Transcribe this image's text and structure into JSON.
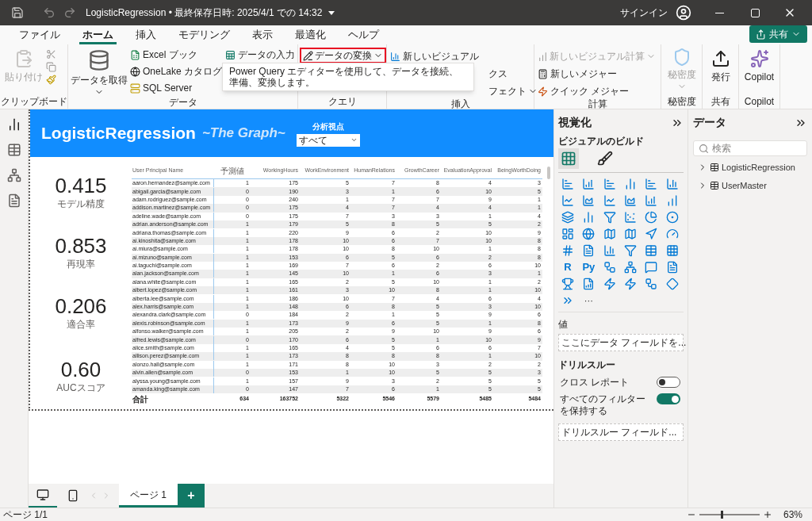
{
  "window": {
    "title": "LogisticRegression • 最終保存日時: 2025/4/1 での 14:32",
    "sign_in": "サインイン"
  },
  "menu_tabs": [
    {
      "label": "ファイル",
      "selected": false
    },
    {
      "label": "ホーム",
      "selected": true
    },
    {
      "label": "挿入",
      "selected": false
    },
    {
      "label": "モデリング",
      "selected": false
    },
    {
      "label": "表示",
      "selected": false
    },
    {
      "label": "最適化",
      "selected": false
    },
    {
      "label": "ヘルプ",
      "selected": false
    }
  ],
  "share_button": "共有",
  "ribbon": {
    "clipboard": {
      "paste": "貼り付け",
      "label": "クリップボード"
    },
    "data": {
      "get_data": "データを取得",
      "excel": "Excel ブック",
      "onelake": "OneLake カタログ",
      "sql": "SQL Server",
      "enter_data": "データの入力",
      "label": "データ"
    },
    "query": {
      "transform": "データの変換",
      "label": "クエリ"
    },
    "insert": {
      "new_visual": "新しいビジュアル",
      "item_2": "クス",
      "item_3": "フェクト",
      "label": "挿入"
    },
    "calc": {
      "visual_calc": "新しいビジュアル計算",
      "new_measure": "新しいメジャー",
      "quick_measure": "クイック メジャー",
      "label": "計算"
    },
    "sensitivity": {
      "button": "秘密度",
      "label": "秘密度"
    },
    "share": {
      "publish": "発行",
      "label": "共有"
    },
    "copilot": {
      "button": "Copilot",
      "label": "Copilot"
    }
  },
  "tooltip": "Power Query エディターを使用して、データを接続、準備、変換します。",
  "report": {
    "title": "LogisticRegression",
    "subtitle": "~The Graph~",
    "slicer": {
      "label": "分析視点",
      "value": "すべて"
    },
    "kpis": [
      {
        "value": "0.415",
        "label": "モデル精度"
      },
      {
        "value": "0.853",
        "label": "再現率"
      },
      {
        "value": "0.206",
        "label": "適合率"
      },
      {
        "value": "0.60",
        "label": "AUCスコア"
      }
    ],
    "table": {
      "columns": [
        "User Principal Name",
        "予測値",
        "WorkingHours",
        "WorkEnvironment",
        "HumanRelations",
        "GrowthCareer",
        "EvaluationApproval",
        "BeingWorthDoing"
      ],
      "rows": [
        [
          "aaron.hernandez@sample.com",
          "1",
          "175",
          "5",
          "7",
          "8",
          "4",
          "3"
        ],
        [
          "abigail.garcia@sample.com",
          "0",
          "190",
          "3",
          "1",
          "6",
          "10",
          "5"
        ],
        [
          "adam.rodriguez@sample.com",
          "0",
          "240",
          "1",
          "7",
          "7",
          "9",
          "1"
        ],
        [
          "addison.martinez@sample.com",
          "0",
          "175",
          "4",
          "7",
          "4",
          "4",
          "1"
        ],
        [
          "adeline.wade@sample.com",
          "0",
          "175",
          "7",
          "3",
          "3",
          "1",
          "4"
        ],
        [
          "adrian.anderson@sample.com",
          "1",
          "179",
          "5",
          "8",
          "5",
          "5",
          "2"
        ],
        [
          "adriana.thomas@sample.com",
          "1",
          "220",
          "9",
          "6",
          "2",
          "10",
          "9"
        ],
        [
          "ai.kinoshita@sample.com",
          "1",
          "178",
          "10",
          "6",
          "7",
          "10",
          "8"
        ],
        [
          "ai.miura@sample.com",
          "1",
          "178",
          "10",
          "8",
          "10",
          "1",
          "8"
        ],
        [
          "ai.mizuno@sample.com",
          "1",
          "153",
          "6",
          "5",
          "6",
          "2",
          "8"
        ],
        [
          "ai.taguchi@sample.com",
          "1",
          "169",
          "7",
          "6",
          "2",
          "6",
          "10"
        ],
        [
          "alan.jackson@sample.com",
          "1",
          "145",
          "10",
          "1",
          "6",
          "3",
          "1"
        ],
        [
          "alana.white@sample.com",
          "1",
          "165",
          "2",
          "5",
          "10",
          "1",
          "2"
        ],
        [
          "albert.lopez@sample.com",
          "1",
          "161",
          "3",
          "10",
          "8",
          "1",
          "10"
        ],
        [
          "alberta.lee@sample.com",
          "1",
          "186",
          "10",
          "7",
          "4",
          "6",
          "4"
        ],
        [
          "alex.harris@sample.com",
          "1",
          "148",
          "6",
          "8",
          "5",
          "3",
          "10"
        ],
        [
          "alexandra.clark@sample.com",
          "0",
          "184",
          "2",
          "1",
          "5",
          "9",
          "6"
        ],
        [
          "alexis.robinson@sample.com",
          "1",
          "173",
          "9",
          "6",
          "5",
          "1",
          "8"
        ],
        [
          "alfonso.walker@sample.com",
          "1",
          "205",
          "2",
          "9",
          "10",
          "9",
          "6"
        ],
        [
          "alfred.lewis@sample.com",
          "0",
          "170",
          "6",
          "5",
          "1",
          "10",
          "9"
        ],
        [
          "alice.smith@sample.com",
          "1",
          "165",
          "4",
          "5",
          "6",
          "6",
          "7"
        ],
        [
          "allison.perez@sample.com",
          "1",
          "173",
          "8",
          "8",
          "8",
          "1",
          "10"
        ],
        [
          "alonzo.hall@sample.com",
          "1",
          "171",
          "8",
          "10",
          "3",
          "2",
          "2"
        ],
        [
          "alvin.allen@sample.com",
          "0",
          "153",
          "1",
          "10",
          "5",
          "5",
          "3"
        ],
        [
          "alyssa.young@sample.com",
          "1",
          "157",
          "9",
          "3",
          "2",
          "5",
          "5"
        ],
        [
          "amanda.king@sample.com",
          "0",
          "147",
          "7",
          "6",
          "1",
          "5",
          "5"
        ]
      ],
      "total": [
        "合計",
        "634",
        "163752",
        "5322",
        "5546",
        "5579",
        "5485",
        "5484"
      ]
    }
  },
  "visualizations": {
    "title": "視覚化",
    "build_label": "ビジュアルのビルド",
    "modes": [
      {
        "kind": "build",
        "selected": true
      },
      {
        "kind": "format",
        "selected": false
      }
    ],
    "r_label": "R",
    "py_label": "Py",
    "more": "···",
    "values_label": "値",
    "values_placeholder": "ここにデータ フィールドを...",
    "drillthrough": "ドリルスルー",
    "toggles": [
      {
        "label": "クロス レポート",
        "on": false
      },
      {
        "label": "すべてのフィルターを保持する",
        "on": true
      }
    ],
    "drill_placeholder": "ドリルスルー フィールド..."
  },
  "data_pane": {
    "title": "データ",
    "search_placeholder": "検索",
    "tables": [
      {
        "name": "LogisticRegression",
        "expanded": false
      },
      {
        "name": "UserMaster",
        "expanded": false
      }
    ]
  },
  "pages": [
    {
      "label": "ページ 1",
      "selected": true
    }
  ],
  "add_page": "+",
  "status_bar": {
    "page": "ページ 1/1",
    "zoom": "63%",
    "zoom_slider": {
      "level": 0.35
    }
  }
}
